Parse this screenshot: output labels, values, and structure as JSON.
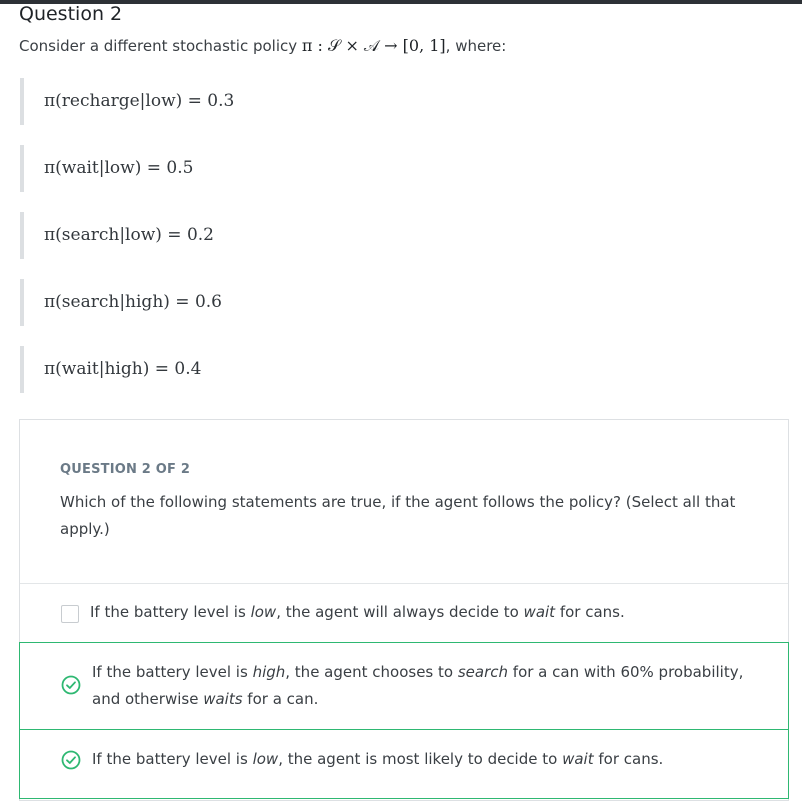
{
  "question": {
    "title": "Question 2",
    "intro_prefix": "Consider a different stochastic policy ",
    "intro_math": "π : 𝒮 × 𝒜 → [0, 1]",
    "intro_suffix": ", where:"
  },
  "policy": [
    {
      "expr": "π(recharge|low) = 0.3"
    },
    {
      "expr": "π(wait|low) = 0.5"
    },
    {
      "expr": "π(search|low) = 0.2"
    },
    {
      "expr": "π(search|high) = 0.6"
    },
    {
      "expr": "π(wait|high) = 0.4"
    }
  ],
  "quiz": {
    "counter": "QUESTION 2 OF 2",
    "prompt": "Which of the following statements are true, if the agent follows the policy? (Select all that apply.)",
    "choices": [
      {
        "parts": [
          "If the battery level is ",
          "low",
          ", the agent will always decide to ",
          "wait",
          " for cans."
        ],
        "selected": false
      },
      {
        "parts": [
          "If the battery level is ",
          "high",
          ", the agent chooses to ",
          "search",
          " for a can with 60% probability, and otherwise ",
          "waits",
          " for a can."
        ],
        "selected": true
      },
      {
        "parts": [
          "If the battery level is ",
          "low",
          ", the agent is most likely to decide to ",
          "wait",
          " for cans."
        ],
        "selected": true
      }
    ]
  },
  "colors": {
    "accent_green": "#2eb872",
    "counter_gray": "#6b7a87",
    "left_bar": "#dcdfe2"
  }
}
